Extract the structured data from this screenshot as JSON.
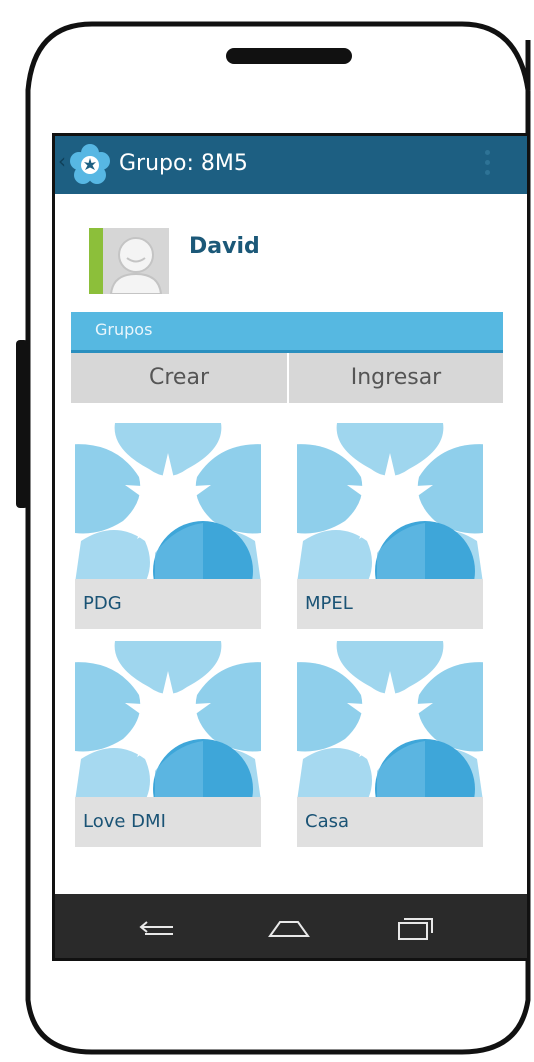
{
  "action_bar": {
    "back_glyph": "‹",
    "app_icon": "flower-icon",
    "title": "Grupo: 8M5",
    "overflow_icon": "overflow-menu-icon"
  },
  "profile": {
    "name": "David",
    "avatar_icon": "avatar-placeholder-icon",
    "accent_color": "#8cbf3a"
  },
  "groups": {
    "header": "Grupos",
    "create_label": "Crear",
    "join_label": "Ingresar",
    "items": [
      {
        "name": "PDG"
      },
      {
        "name": "MPEL"
      },
      {
        "name": "Love DMI"
      },
      {
        "name": "Casa"
      }
    ]
  },
  "nav_bar": {
    "back_icon": "back-icon",
    "home_icon": "home-icon",
    "recents_icon": "recent-apps-icon"
  },
  "colors": {
    "action_bar": "#1d5f82",
    "section_header": "#56b8e1",
    "tab_background": "#d7d7d7",
    "label_text": "#1a5375"
  }
}
